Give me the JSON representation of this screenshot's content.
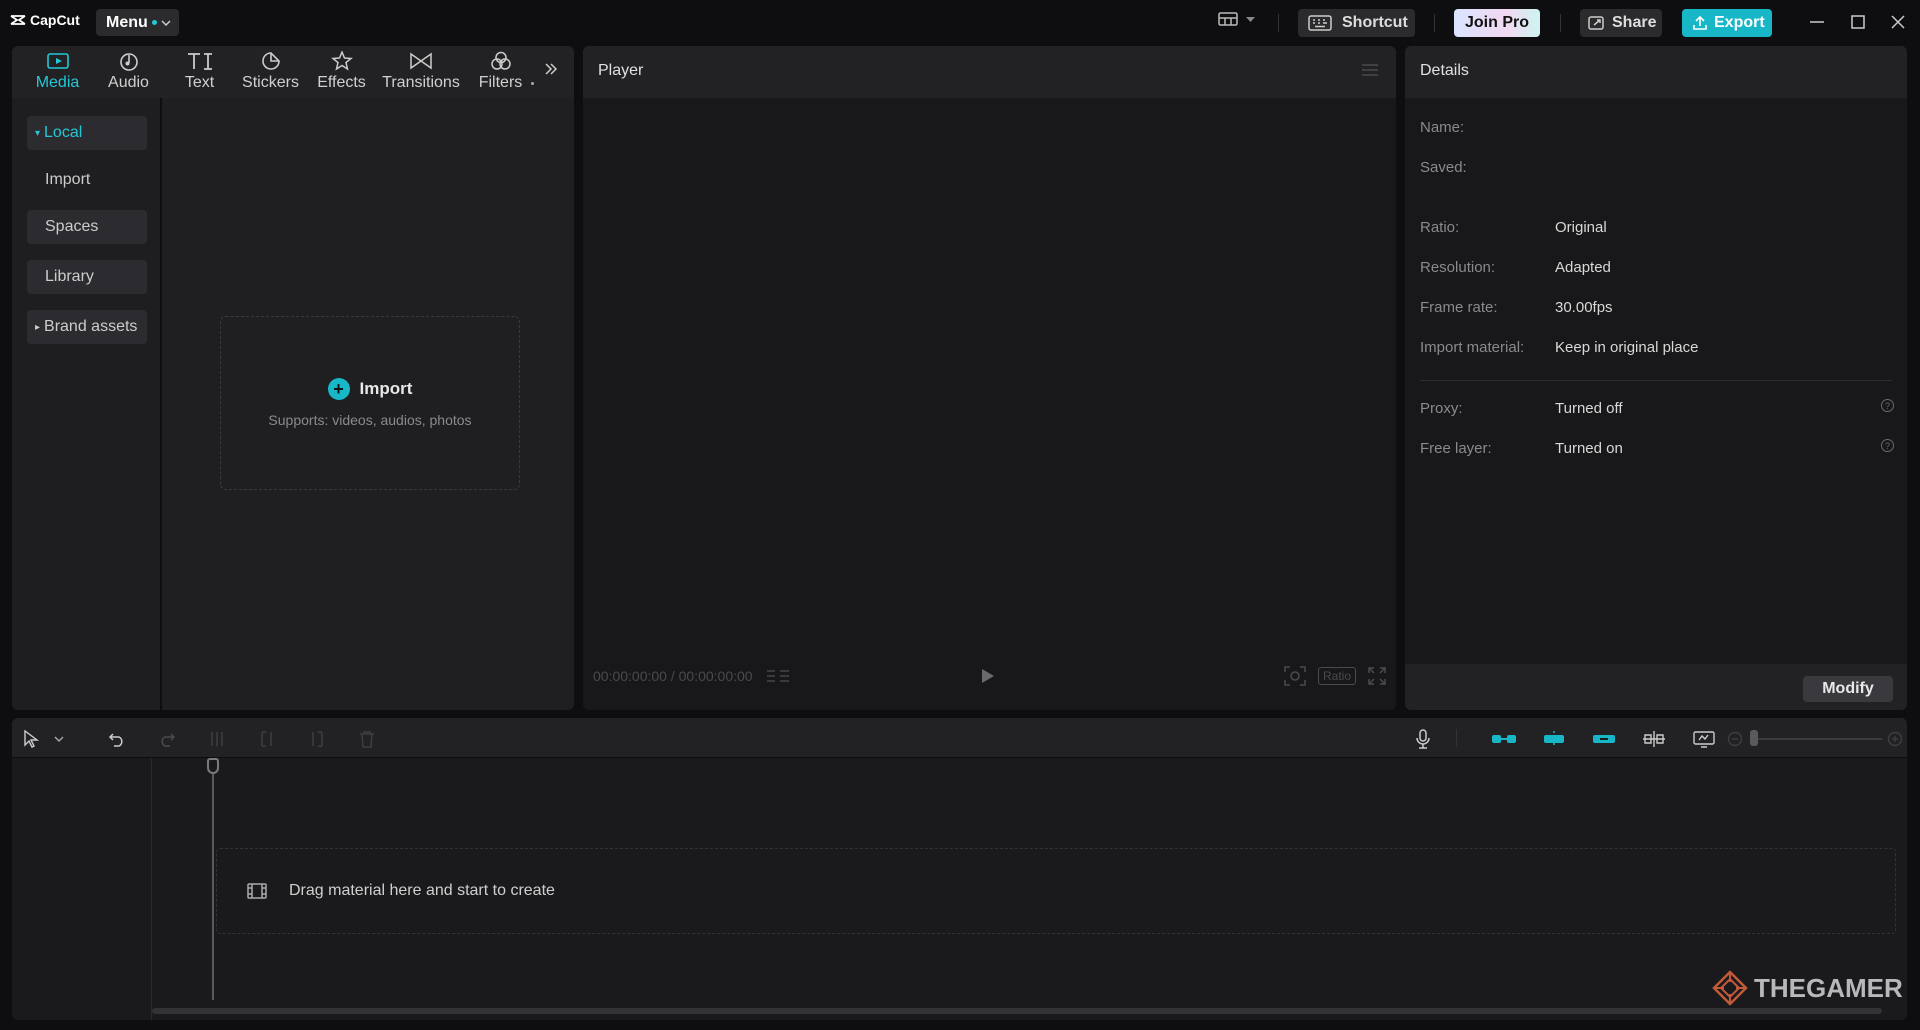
{
  "app": {
    "logo_text": "CapCut",
    "menu_label": "Menu"
  },
  "topbar": {
    "shortcut_label": "Shortcut",
    "join_pro_label": "Join Pro",
    "share_label": "Share",
    "export_label": "Export"
  },
  "media": {
    "tabs": [
      {
        "label": "Media",
        "icon": "media-icon"
      },
      {
        "label": "Audio",
        "icon": "audio-icon"
      },
      {
        "label": "Text",
        "icon": "text-icon"
      },
      {
        "label": "Stickers",
        "icon": "stickers-icon"
      },
      {
        "label": "Effects",
        "icon": "effects-icon"
      },
      {
        "label": "Transitions",
        "icon": "transitions-icon"
      },
      {
        "label": "Filters",
        "icon": "filters-icon"
      }
    ],
    "side": [
      {
        "label": "Local"
      },
      {
        "label": "Import"
      },
      {
        "label": "Spaces"
      },
      {
        "label": "Library"
      },
      {
        "label": "Brand assets"
      }
    ],
    "import_label": "Import",
    "import_hint": "Supports: videos, audios, photos"
  },
  "player": {
    "title": "Player",
    "timecode": "00:00:00:00 / 00:00:00:00",
    "ratio_label": "Ratio"
  },
  "details": {
    "title": "Details",
    "rows": [
      {
        "label": "Name:",
        "value": ""
      },
      {
        "label": "Saved:",
        "value": ""
      },
      {
        "label": "Ratio:",
        "value": "Original"
      },
      {
        "label": "Resolution:",
        "value": "Adapted"
      },
      {
        "label": "Frame rate:",
        "value": "30.00fps"
      },
      {
        "label": "Import material:",
        "value": "Keep in original place"
      },
      {
        "label": "Proxy:",
        "value": "Turned off"
      },
      {
        "label": "Free layer:",
        "value": "Turned on"
      }
    ],
    "modify_label": "Modify"
  },
  "timeline": {
    "drop_hint": "Drag material here and start to create"
  },
  "watermark": "THEGAMER",
  "colors": {
    "accent": "#18b7c8",
    "background": "#0e0e10",
    "panel": "#1f1f22"
  }
}
